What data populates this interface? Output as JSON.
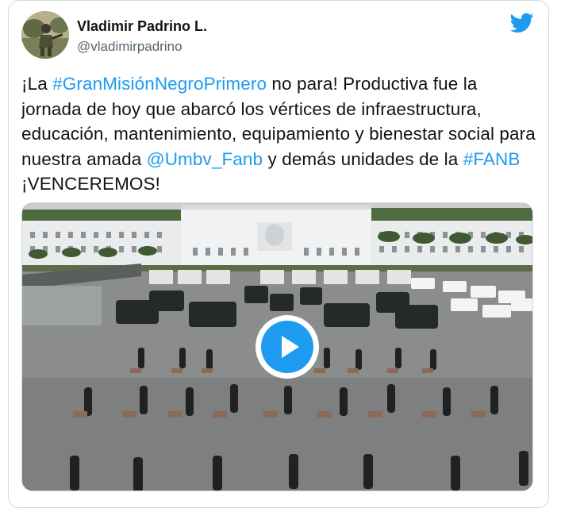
{
  "author": {
    "name": "Vladimir Padrino L.",
    "handle": "@vladimirpadrino"
  },
  "tweet": {
    "parts": [
      {
        "text": "¡La ",
        "type": "text"
      },
      {
        "text": "#GranMisiónNegroPrimero",
        "type": "link"
      },
      {
        "text": " no para! Productiva fue la jornada de hoy que abarcó los vértices de infraestructura, educación, mantenimiento, equipamiento y bienestar social para nuestra amada ",
        "type": "text"
      },
      {
        "text": "@Umbv_Fanb",
        "type": "link"
      },
      {
        "text": " y demás unidades de la ",
        "type": "text"
      },
      {
        "text": "#FANB",
        "type": "link"
      },
      {
        "text": " ¡VENCEREMOS!",
        "type": "text"
      }
    ]
  },
  "media": {
    "type": "video",
    "play_icon": "play-icon"
  },
  "icons": {
    "brand": "twitter-bird-icon",
    "avatar": "avatar"
  },
  "colors": {
    "link": "#1d9bf0",
    "text": "#0f1419",
    "secondary": "#536471",
    "border": "#cfd9de"
  }
}
